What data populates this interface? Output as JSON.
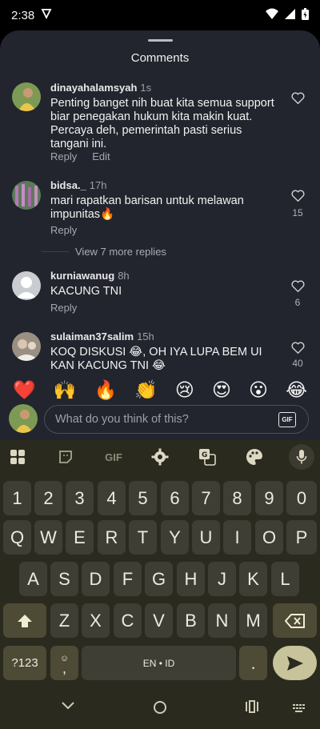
{
  "status_bar": {
    "time": "2:38"
  },
  "sheet": {
    "title": "Comments"
  },
  "comments": [
    {
      "username": "dinayahalamsyah",
      "ago": "1s",
      "text": "Penting banget nih buat kita semua support biar penegakan hukum kita makin kuat. Percaya deh, pemerintah pasti serius tangani ini.",
      "reply_label": "Reply",
      "edit_label": "Edit",
      "likes": ""
    },
    {
      "username": "bidsa._",
      "ago": "17h",
      "text": "mari rapatkan barisan untuk melawan impunitas🔥",
      "reply_label": "Reply",
      "likes": "15"
    },
    {
      "username": "kurniawanug",
      "ago": "8h",
      "text": "KACUNG TNI",
      "reply_label": "Reply",
      "likes": "6"
    },
    {
      "username": "sulaiman37salim",
      "ago": "15h",
      "text": "KOQ DISKUSI 😂, OH IYA LUPA BEM UI KAN KACUNG TNI 😂",
      "likes": "40"
    }
  ],
  "view_more_replies": "View 7 more replies",
  "emoji_bar": [
    "❤️",
    "🙌",
    "🔥",
    "👏",
    "😢",
    "😍",
    "😮",
    "😂"
  ],
  "input": {
    "placeholder": "What do you think of this?",
    "gif_label": "GIF"
  },
  "keyboard": {
    "toolbar_gif": "GIF",
    "row_numbers": [
      "1",
      "2",
      "3",
      "4",
      "5",
      "6",
      "7",
      "8",
      "9",
      "0"
    ],
    "row1": [
      "Q",
      "W",
      "E",
      "R",
      "T",
      "Y",
      "U",
      "I",
      "O",
      "P"
    ],
    "row2": [
      "A",
      "S",
      "D",
      "F",
      "G",
      "H",
      "J",
      "K",
      "L"
    ],
    "row3": [
      "Z",
      "X",
      "C",
      "V",
      "B",
      "N",
      "M"
    ],
    "symbols_key": "?123",
    "comma_key": ",",
    "space_label": "EN • ID",
    "period_key": "."
  }
}
